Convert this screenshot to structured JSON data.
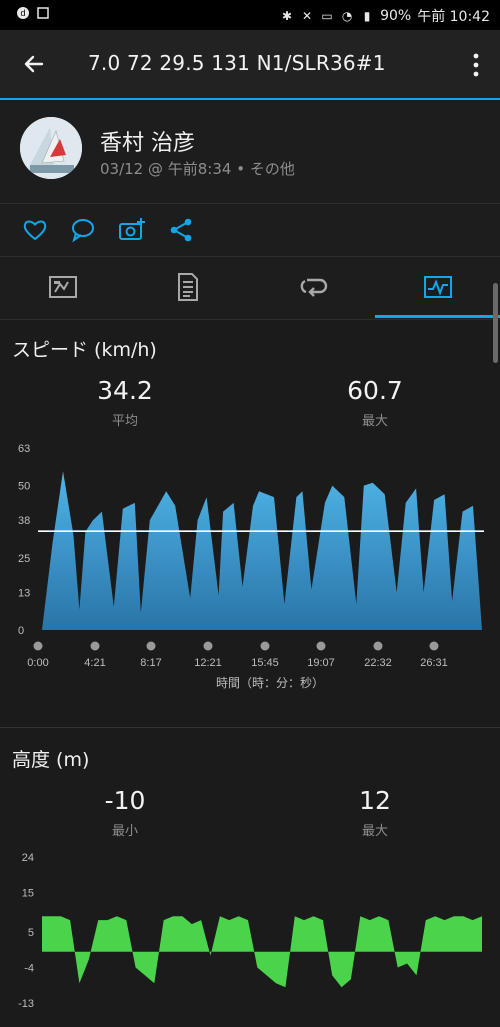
{
  "status": {
    "battery": "90%",
    "time": "午前 10:42"
  },
  "appbar": {
    "title": "7.0  72  29.5  131  N1/SLR36#1"
  },
  "header": {
    "user_name": "香村 治彦",
    "subtitle": "03/12 @ 午前8:34 • その他"
  },
  "speed": {
    "title": "スピード (km/h)",
    "avg_value": "34.2",
    "avg_label": "平均",
    "max_value": "60.7",
    "max_label": "最大",
    "x_axis_title": "時間（時：分：秒）"
  },
  "altitude": {
    "title": "高度 (m)",
    "min_value": "-10",
    "min_label": "最小",
    "max_value": "12",
    "max_label": "最大"
  },
  "colors": {
    "accent": "#11a7e8",
    "speed_fill": "#3a9ad0",
    "altitude_fill": "#4bd34b"
  },
  "chart_data": [
    {
      "type": "area",
      "title": "スピード (km/h)",
      "xlabel": "時間（時：分：秒）",
      "x_tick_labels": [
        "0:00",
        "4:21",
        "8:17",
        "12:21",
        "15:45",
        "19:07",
        "22:32",
        "26:31"
      ],
      "y_tick_labels": [
        "0",
        "13",
        "25",
        "38",
        "50",
        "63"
      ],
      "ylim": [
        0,
        63
      ],
      "average_line": 34.2,
      "x_minutes": [
        0,
        0.7,
        1.4,
        2.1,
        2.5,
        2.9,
        3.4,
        4.0,
        4.8,
        5.4,
        6.2,
        6.6,
        7.2,
        8.3,
        8.9,
        9.9,
        10.4,
        11.0,
        11.8,
        12.1,
        12.8,
        13.4,
        14.1,
        14.5,
        15.5,
        16.2,
        17.0,
        17.4,
        18.0,
        18.9,
        19.4,
        20.2,
        21.0,
        21.5,
        22.1,
        22.9,
        23.7,
        24.3,
        25.0,
        25.5,
        26.2,
        26.9,
        27.4,
        28.1,
        28.8,
        29.4
      ],
      "values": [
        0,
        30,
        55,
        33,
        7,
        34,
        38,
        41,
        8,
        42,
        44,
        6,
        38,
        48,
        43,
        11,
        38,
        46,
        12,
        41,
        44,
        15,
        43,
        48,
        46,
        9,
        46,
        48,
        14,
        44,
        50,
        46,
        9,
        50,
        51,
        47,
        13,
        44,
        49,
        13,
        45,
        47,
        10,
        41,
        43,
        0
      ],
      "series": [
        {
          "values": [
            0,
            30,
            55,
            33,
            7,
            34,
            38,
            41,
            8,
            42,
            44,
            6,
            38,
            48,
            43,
            11,
            38,
            46,
            12,
            41,
            44,
            15,
            43,
            48,
            46,
            9,
            46,
            48,
            14,
            44,
            50,
            46,
            9,
            50,
            51,
            47,
            13,
            44,
            49,
            13,
            45,
            47,
            10,
            41,
            43,
            0
          ]
        }
      ]
    },
    {
      "type": "area",
      "title": "高度 (m)",
      "y_tick_labels": [
        "24",
        "15",
        "5",
        "-4",
        "-13"
      ],
      "ylim": [
        -13,
        24
      ],
      "series": [
        {
          "values": [
            9,
            9,
            9,
            8,
            -8,
            -2,
            8,
            8,
            9,
            8,
            -4,
            -6,
            -8,
            8,
            9,
            9,
            7,
            8,
            -1,
            9,
            8,
            9,
            8,
            -4,
            -6,
            -8,
            -9,
            9,
            8,
            9,
            8,
            -6,
            -9,
            -7,
            9,
            8,
            9,
            8,
            -4,
            -3,
            -6,
            8,
            9,
            8,
            9,
            9,
            8,
            9
          ]
        }
      ]
    }
  ]
}
